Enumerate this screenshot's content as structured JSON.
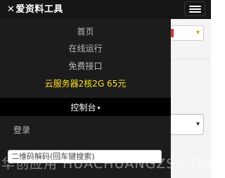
{
  "navbar": {
    "brand": "爱资料工具",
    "brand_mark": "✕",
    "menu_toggle_icon": "hamburger-icon"
  },
  "menu": {
    "items": [
      {
        "label": "首页"
      },
      {
        "label": "在线运行"
      },
      {
        "label": "免费接口"
      }
    ],
    "promo": {
      "label": "云服务器2核2G 65元",
      "color": "#ffe11a"
    },
    "console": {
      "label": "控制台",
      "caret": "▾"
    },
    "login": {
      "label": "登录"
    },
    "search": {
      "placeholder": "二维码解码(回车键搜索)"
    }
  },
  "background": {
    "select_caret": "▾"
  },
  "watermark": {
    "text": "华创应用 HUACHUANGZS.COM"
  },
  "colors": {
    "navbar_bg": "#161616",
    "dropdown_bg": "#1c1c1c",
    "console_bg": "#000000",
    "menu_text": "#bcbcbc",
    "promo_text": "#ffe11a",
    "accent_red": "#d9362b"
  }
}
